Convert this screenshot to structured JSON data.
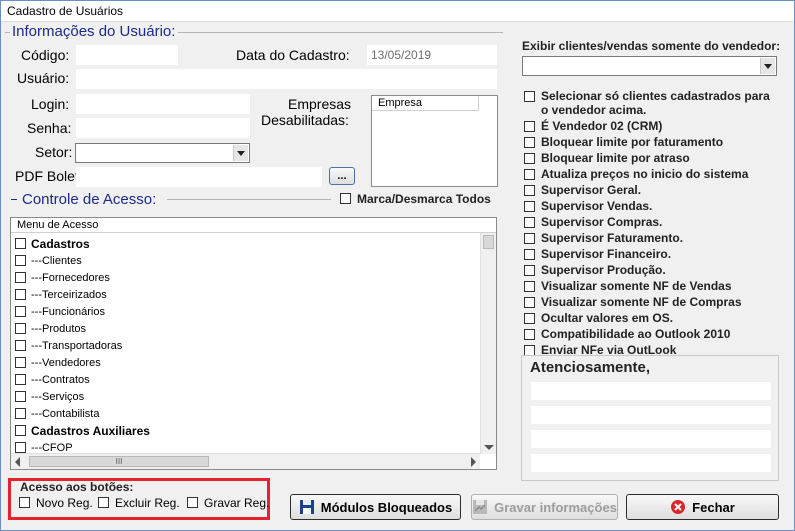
{
  "window": {
    "title": "Cadastro de Usuários"
  },
  "user_info": {
    "section_title": "Informações do Usuário:",
    "codigo_label": "Código:",
    "codigo_value": "",
    "data_cadastro_label": "Data do Cadastro:",
    "data_cadastro_value": "13/05/2019",
    "usuario_label": "Usuário:",
    "usuario_value": "",
    "login_label": "Login:",
    "login_value": "",
    "senha_label": "Senha:",
    "senha_value": "",
    "setor_label": "Setor:",
    "setor_value": "",
    "pdf_label": "PDF Boleto:",
    "pdf_value": "",
    "browse_label": "...",
    "empresas_label_1": "Empresas",
    "empresas_label_2": "Desabilitadas:",
    "empresas_column": "Empresa"
  },
  "access": {
    "section_title": "Controle de Acesso:",
    "toggle_all_label": "Marca/Desmarca Todos",
    "list_header": "Menu de Acesso",
    "items": [
      {
        "label": "Cadastros",
        "bold": true
      },
      {
        "label": "---Clientes",
        "bold": false
      },
      {
        "label": "---Fornecedores",
        "bold": false
      },
      {
        "label": "---Terceirizados",
        "bold": false
      },
      {
        "label": "---Funcionários",
        "bold": false
      },
      {
        "label": "---Produtos",
        "bold": false
      },
      {
        "label": "---Transportadoras",
        "bold": false
      },
      {
        "label": "---Vendedores",
        "bold": false
      },
      {
        "label": "---Contratos",
        "bold": false
      },
      {
        "label": "---Serviços",
        "bold": false
      },
      {
        "label": "---Contabilista",
        "bold": false
      },
      {
        "label": "Cadastros Auxiliares",
        "bold": true
      },
      {
        "label": "---CFOP",
        "bold": false
      }
    ],
    "hscroll_grip": "III"
  },
  "buttons_access": {
    "title": "Acesso aos botões:",
    "novo": "Novo Reg.",
    "excluir": "Excluir Reg.",
    "gravar": "Gravar Reg."
  },
  "right_panel": {
    "vendor_label": "Exibir clientes/vendas somente do vendedor:",
    "vendor_value": "",
    "options": [
      "Selecionar só clientes cadastrados para o vendedor acima.",
      "É Vendedor 02 (CRM)",
      "Bloquear limite por faturamento",
      "Bloquear limite por atraso",
      "Atualiza preços no inicio do sistema",
      "Supervisor Geral.",
      "Supervisor Vendas.",
      "Supervisor Compras.",
      "Supervisor Faturamento.",
      "Supervisor Financeiro.",
      "Supervisor Produção.",
      "Visualizar somente NF de Vendas",
      "Visualizar somente NF de Compras",
      "Ocultar valores em OS.",
      "Compatibilidade ao Outlook 2010",
      "Enviar NFe via OutLook"
    ],
    "signature_title": "Atenciosamente,"
  },
  "footer": {
    "modulos": "Módulos Bloqueados",
    "gravar": "Gravar informações",
    "fechar": "Fechar"
  },
  "colors": {
    "section_title": "#1c2a8a",
    "highlight": "#e3252b",
    "fechar_icon": "#d9262c"
  }
}
